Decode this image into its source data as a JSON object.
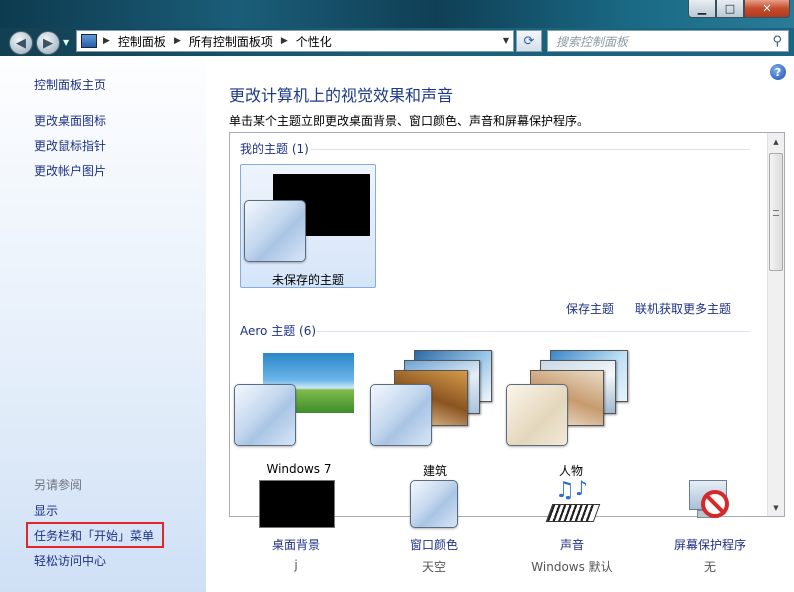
{
  "window": {
    "minimize": "▁",
    "maximize": "□",
    "close": "✕"
  },
  "nav": {
    "back_icon": "◀",
    "forward_icon": "▶"
  },
  "address": {
    "crumbs": [
      "控制面板",
      "所有控制面板项",
      "个性化"
    ]
  },
  "search": {
    "placeholder": "搜索控制面板"
  },
  "sidebar": {
    "home": "控制面板主页",
    "links": [
      "更改桌面图标",
      "更改鼠标指针",
      "更改帐户图片"
    ],
    "see_also": "另请参阅",
    "see_links": [
      "显示",
      "任务栏和「开始」菜单",
      "轻松访问中心"
    ]
  },
  "main": {
    "title": "更改计算机上的视觉效果和声音",
    "description": "单击某个主题立即更改桌面背景、窗口颜色、声音和屏幕保护程序。",
    "my_themes": "我的主题 (1)",
    "unsaved_label": "未保存的主题",
    "save_theme": "保存主题",
    "get_more": "联机获取更多主题",
    "aero_themes": "Aero 主题 (6)",
    "aero": [
      "Windows 7",
      "建筑",
      "人物"
    ]
  },
  "bottom": [
    {
      "label": "桌面背景",
      "value": "j"
    },
    {
      "label": "窗口颜色",
      "value": "天空"
    },
    {
      "label": "声音",
      "value": "Windows 默认"
    },
    {
      "label": "屏幕保护程序",
      "value": "无"
    }
  ],
  "colors": {
    "link": "#1e3287",
    "highlight": "#e3262a"
  }
}
